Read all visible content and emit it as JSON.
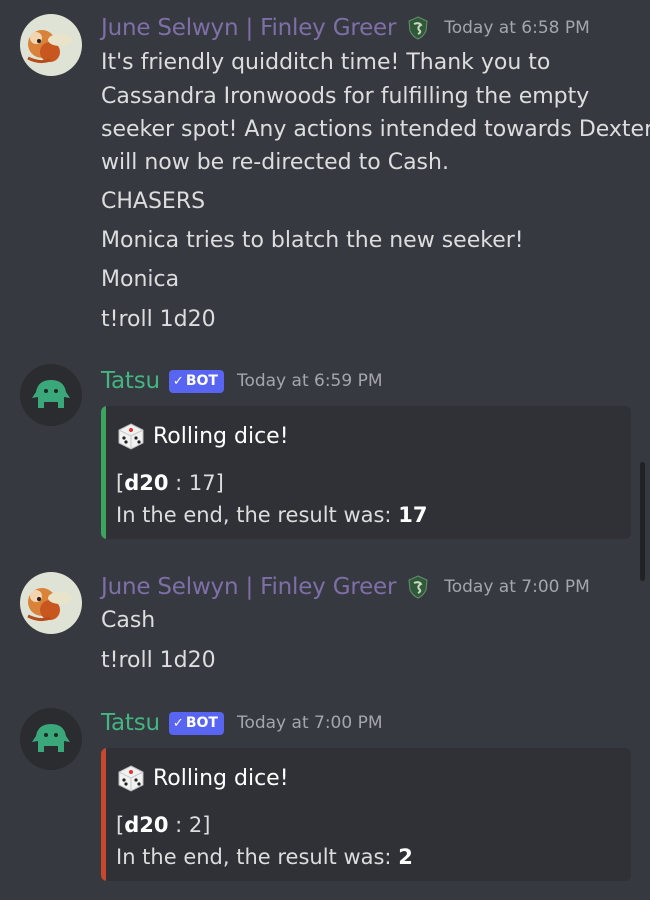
{
  "colors": {
    "background": "#36393f",
    "june_name": "#7f6fa8",
    "tatsu_name": "#43b581",
    "bot_tag": "#5865f2",
    "embed_bg": "#2f3136",
    "embed_bar_green": "#3ba55d",
    "embed_bar_red": "#c8482d"
  },
  "messages": [
    {
      "author": "June Selwyn | Finley Greer",
      "badge_icon": "snake-crest-icon",
      "timestamp": "Today at 6:58 PM",
      "lines": [
        "It's friendly quidditch time! Thank you to",
        "Cassandra Ironwoods for fulfilling the empty",
        "seeker spot! Any actions intended towards Dexter",
        "will now be re-directed to Cash.",
        "CHASERS",
        "Monica tries to blatch the new seeker!",
        "Monica",
        "t!roll 1d20"
      ]
    },
    {
      "author": "Tatsu",
      "bot_tag": "BOT",
      "bot_check": "✓",
      "timestamp": "Today at 6:59 PM",
      "embed": {
        "die_icon": "dice-icon",
        "title": "Rolling dice!",
        "roll_open": "[",
        "roll_die": "d20",
        "roll_value": ": 17]",
        "result_prefix": "In the end, the result was:",
        "result_value": "17"
      }
    },
    {
      "author": "June Selwyn | Finley Greer",
      "badge_icon": "snake-crest-icon",
      "timestamp": "Today at 7:00 PM",
      "lines": [
        "Cash",
        "t!roll 1d20"
      ]
    },
    {
      "author": "Tatsu",
      "bot_tag": "BOT",
      "bot_check": "✓",
      "timestamp": "Today at 7:00 PM",
      "embed": {
        "die_icon": "dice-icon",
        "title": "Rolling dice!",
        "roll_open": "[",
        "roll_die": "d20",
        "roll_value": ": 2]",
        "result_prefix": "In the end, the result was:",
        "result_value": "2"
      }
    }
  ]
}
